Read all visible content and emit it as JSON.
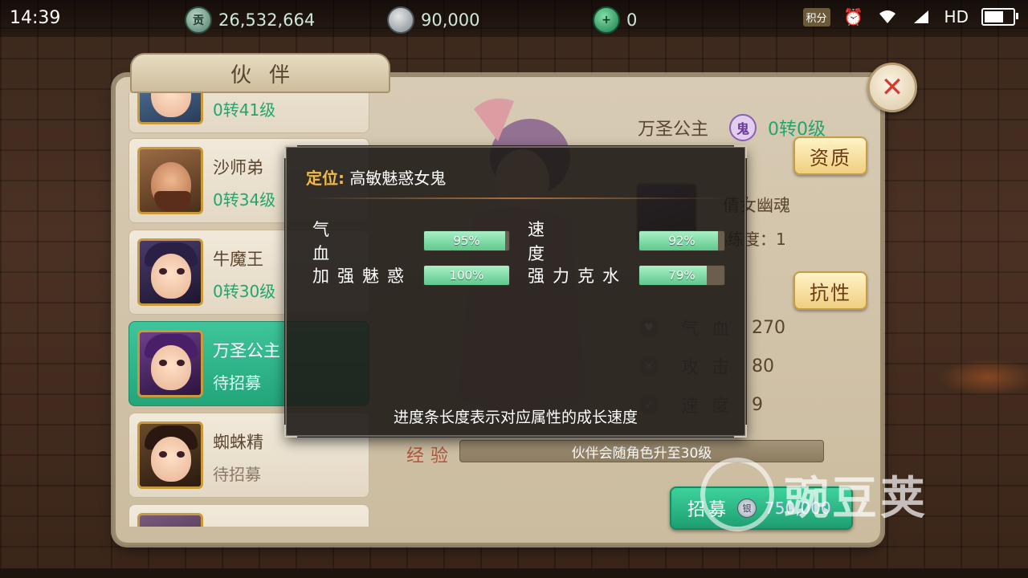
{
  "status_bar": {
    "time": "14:39",
    "currency_1": "26,532,664",
    "currency_1_icon": "贡",
    "currency_2": "90,000",
    "currency_3": "0",
    "network": "HD",
    "points_label": "积分"
  },
  "panel": {
    "title": "伙伴"
  },
  "partners": [
    {
      "name": "",
      "level": "0转41级",
      "selected": false
    },
    {
      "name": "沙师弟",
      "level": "0转34级",
      "selected": false
    },
    {
      "name": "牛魔王",
      "level": "0转30级",
      "selected": false
    },
    {
      "name": "万圣公主",
      "level": "待招募",
      "selected": true
    },
    {
      "name": "蜘蛛精",
      "level": "待招募",
      "selected": false
    }
  ],
  "detail": {
    "name": "万圣公主",
    "race_badge": "鬼",
    "level": "0转0级",
    "aptitude_button": "资质",
    "resistance_button": "抗性",
    "skill_name": "倩女幽魂",
    "proficiency": "熟练度：1",
    "stats": [
      {
        "icon": "heart-icon",
        "label": "气血",
        "value": "270"
      },
      {
        "icon": "sword-icon",
        "label": "攻击",
        "value": "80"
      },
      {
        "icon": "speed-icon",
        "label": "速度",
        "value": "9"
      }
    ],
    "exp_label": "经验",
    "exp_text": "伙伴会随角色升至30级",
    "recruit_label": "招募",
    "recruit_cost": "750,000"
  },
  "tooltip": {
    "role_key": "定位:",
    "role_value": "高敏魅惑女鬼",
    "stats": [
      {
        "label": "气血",
        "value": 0.95,
        "pct_text": "95%"
      },
      {
        "label": "速度",
        "value": 0.92,
        "pct_text": "92%"
      },
      {
        "label": "加强魅惑",
        "value": 1.0,
        "pct_text": "100%"
      },
      {
        "label": "强力克水",
        "value": 0.79,
        "pct_text": "79%"
      }
    ],
    "footer": "进度条长度表示对应属性的成长速度"
  },
  "watermark": "豌豆荚",
  "colors": {
    "accent_green": "#23a57c",
    "tooltip_key": "#f2b94b",
    "close_red": "#d43b30"
  }
}
